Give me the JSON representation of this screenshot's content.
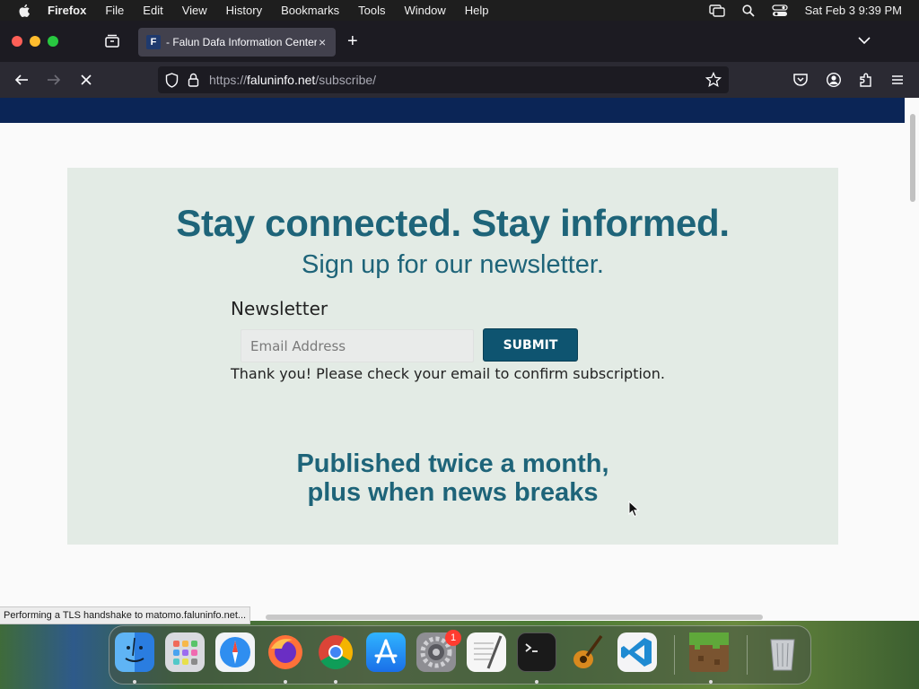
{
  "menubar": {
    "app_name": "Firefox",
    "items": [
      "File",
      "Edit",
      "View",
      "History",
      "Bookmarks",
      "Tools",
      "Window",
      "Help"
    ],
    "clock": "Sat Feb 3  9:39 PM"
  },
  "browser": {
    "tab": {
      "favicon_letter": "F",
      "title": "- Falun Dafa Information Center",
      "close_glyph": "×"
    },
    "new_tab_glyph": "+",
    "url": {
      "prefix": "https://",
      "host": "faluninfo.net",
      "path": "/subscribe/"
    },
    "status_text": "Performing a TLS handshake to matomo.faluninfo.net..."
  },
  "page": {
    "headline": "Stay connected. Stay informed.",
    "subhead": "Sign up for our newsletter.",
    "newsletter_label": "Newsletter",
    "email_placeholder": "Email Address",
    "submit_label": "SUBMIT",
    "thanks_message": "Thank you! Please check your email to confirm subscription.",
    "published_line1": "Published twice a month,",
    "published_line2": "plus when news breaks"
  },
  "dock": {
    "items": [
      "finder-icon",
      "launchpad-icon",
      "safari-icon",
      "firefox-icon",
      "chrome-icon",
      "app-store-icon",
      "system-settings-icon",
      "textedit-icon",
      "terminal-icon",
      "garageband-icon",
      "vscode-icon",
      "minecraft-icon",
      "trash-icon"
    ],
    "settings_badge": "1"
  },
  "colors": {
    "accent_teal": "#1e6479",
    "submit_bg": "#0e5470",
    "card_bg": "#e3ebe5",
    "header_strip": "#0b2556"
  }
}
